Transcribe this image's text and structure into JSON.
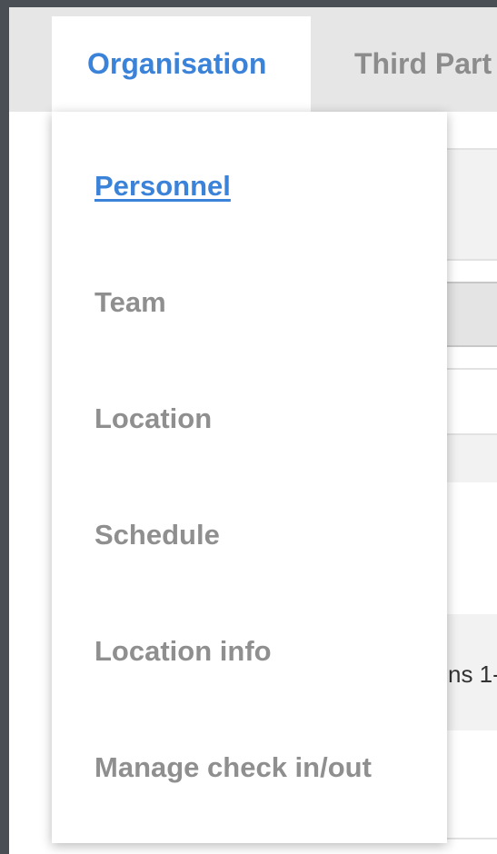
{
  "tabs": {
    "organisation": "Organisation",
    "third_party": "Third Part"
  },
  "background": {
    "peek_text": "ns 1-"
  },
  "menu": {
    "items": [
      {
        "label": "Personnel"
      },
      {
        "label": "Team"
      },
      {
        "label": "Location"
      },
      {
        "label": "Schedule"
      },
      {
        "label": "Location info"
      },
      {
        "label": "Manage check in/out"
      }
    ],
    "active_index": 0
  },
  "colors": {
    "accent": "#3b82d9",
    "muted_text": "#8f8f8f"
  }
}
